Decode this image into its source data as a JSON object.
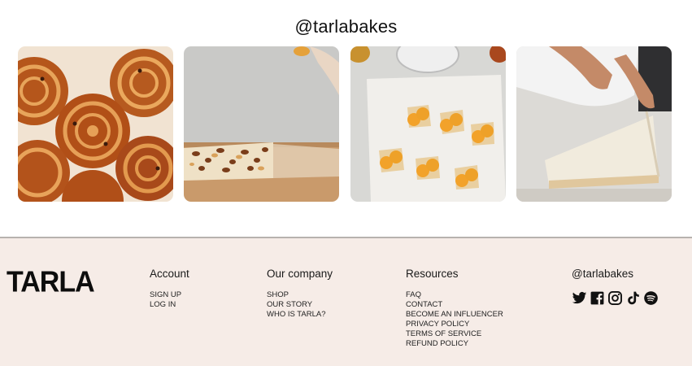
{
  "instagram": {
    "handle": "@tarlabakes",
    "photos": [
      {
        "label": "cinnamon-raisin-swirl-buns"
      },
      {
        "label": "pastry-dough-with-nuts"
      },
      {
        "label": "apricot-danish-pastries"
      },
      {
        "label": "laminated-pastry-dough"
      }
    ]
  },
  "footer": {
    "logo": "TARLA",
    "account": {
      "title": "Account",
      "links": [
        "SIGN UP",
        "LOG IN"
      ]
    },
    "company": {
      "title": "Our company",
      "links": [
        "SHOP",
        "OUR STORY",
        "WHO IS TARLA?"
      ]
    },
    "resources": {
      "title": "Resources",
      "links": [
        "FAQ",
        "CONTACT",
        "BECOME AN INFLUENCER",
        "PRIVACY POLICY",
        "TERMS OF SERVICE",
        "REFUND POLICY"
      ]
    },
    "social": {
      "title": "@tarlabakes",
      "icons": [
        "twitter-icon",
        "facebook-icon",
        "instagram-icon",
        "tiktok-icon",
        "spotify-icon"
      ]
    }
  },
  "colors": {
    "footer_bg": "#f6ece7",
    "footer_border": "#b7b2ae",
    "text": "#111111"
  }
}
